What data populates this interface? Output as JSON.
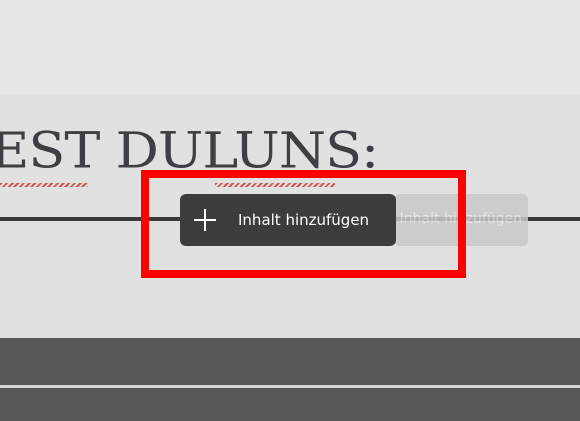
{
  "page": {
    "heading_text": "EST DULUNS:",
    "add_content_label": "Inhalt hinzufügen",
    "ghost_button_label": "Inhalt hinzufügen"
  },
  "icons": {
    "add": "plus-icon"
  },
  "colors": {
    "highlight": "#ff0000",
    "button_background": "#3c3c3c",
    "page_background": "#e4e4e4",
    "footer": "#575757",
    "heading": "#3d3f44"
  }
}
